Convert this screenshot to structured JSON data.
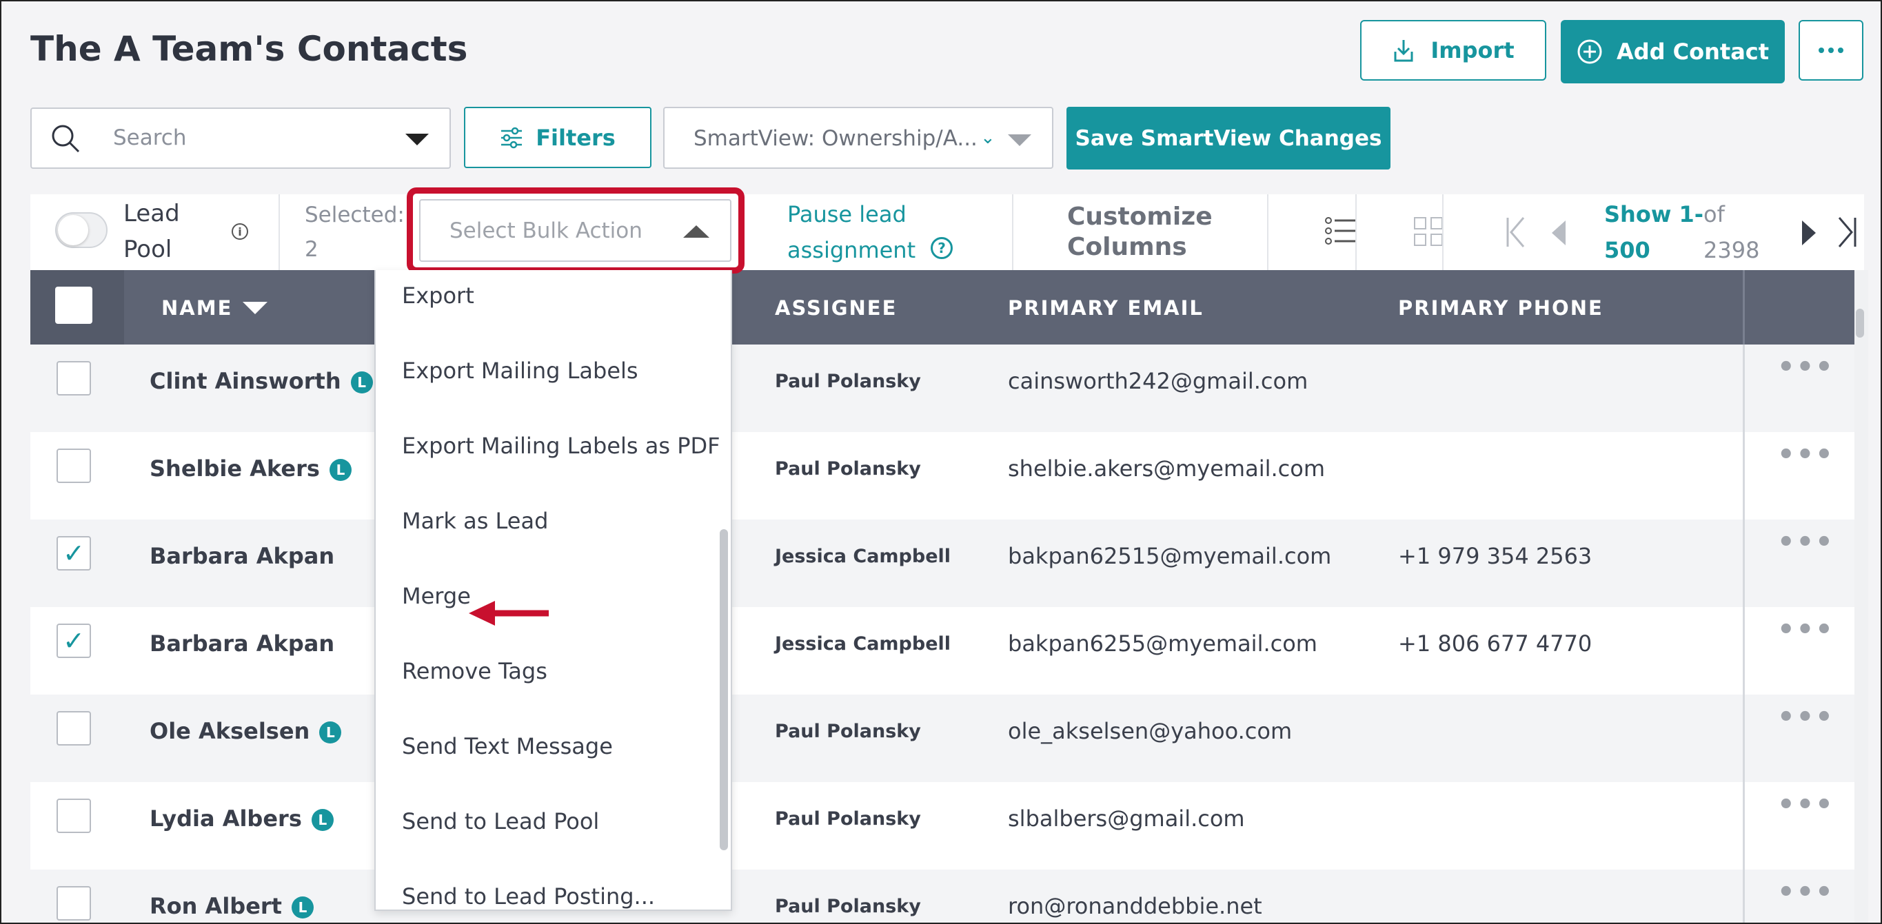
{
  "header": {
    "title": "The A Team's Contacts",
    "import_label": "Import",
    "add_contact_label": "Add Contact",
    "more_label": "…"
  },
  "filters": {
    "search_placeholder": "Search",
    "filters_label": "Filters",
    "smartview_label": "SmartView: Ownership/A...",
    "save_smartview_label": "Save SmartView Changes"
  },
  "toolbar": {
    "lead_pool_line1": "Lead",
    "lead_pool_line2": "Pool",
    "lead_pool_on": false,
    "selected_line1": "Selected:",
    "selected_line2": "2",
    "bulk_action_placeholder": "Select Bulk Action",
    "pause_line1": "Pause lead",
    "pause_line2": "assignment",
    "customize_line1": "Customize",
    "customize_line2": "Columns",
    "show_line1": "Show 1-",
    "show_line2": "500",
    "of_line1": "of",
    "of_line2": "2398"
  },
  "table": {
    "headers": {
      "name": "NAME",
      "assignee": "ASSIGNEE",
      "email": "PRIMARY EMAIL",
      "phone": "PRIMARY PHONE"
    },
    "lead_badge": "L",
    "rows": [
      {
        "name": "Clint Ainsworth",
        "lead": true,
        "checked": false,
        "assignee": "Paul Polansky",
        "email": "cainsworth242@gmail.com",
        "phone": ""
      },
      {
        "name": "Shelbie Akers",
        "lead": true,
        "checked": false,
        "assignee": "Paul Polansky",
        "email": "shelbie.akers@myemail.com",
        "phone": ""
      },
      {
        "name": "Barbara Akpan",
        "lead": false,
        "checked": true,
        "assignee": "Jessica Campbell",
        "email": "bakpan62515@myemail.com",
        "phone": "+1 979 354 2563"
      },
      {
        "name": "Barbara Akpan",
        "lead": false,
        "checked": true,
        "assignee": "Jessica Campbell",
        "email": "bakpan6255@myemail.com",
        "phone": "+1 806 677 4770"
      },
      {
        "name": "Ole Akselsen",
        "lead": true,
        "checked": false,
        "assignee": "Paul Polansky",
        "email": "ole_akselsen@yahoo.com",
        "phone": ""
      },
      {
        "name": "Lydia Albers",
        "lead": true,
        "checked": false,
        "assignee": "Paul Polansky",
        "email": "slbalbers@gmail.com",
        "phone": ""
      },
      {
        "name": "Ron Albert",
        "lead": true,
        "checked": false,
        "assignee": "Paul Polansky",
        "email": "ron@ronanddebbie.net",
        "phone": ""
      }
    ]
  },
  "bulk_menu": {
    "items": [
      "Export",
      "Export Mailing Labels",
      "Export Mailing Labels as PDF",
      "Mark as Lead",
      "Merge",
      "Remove Tags",
      "Send Text Message",
      "Send to Lead Pool",
      "Send to Lead Posting..."
    ],
    "highlighted": "Merge"
  },
  "colors": {
    "accent": "#17959e",
    "highlight_outline": "#c8102e",
    "header_bg": "#5e6474"
  }
}
